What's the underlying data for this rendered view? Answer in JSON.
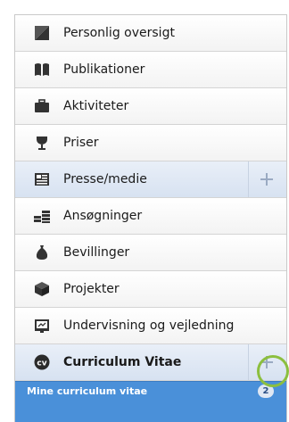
{
  "menu": {
    "items": [
      {
        "label": "Personlig oversigt",
        "icon": "user-card-icon"
      },
      {
        "label": "Publikationer",
        "icon": "book-icon"
      },
      {
        "label": "Aktiviteter",
        "icon": "briefcase-icon"
      },
      {
        "label": "Priser",
        "icon": "trophy-icon"
      },
      {
        "label": "Presse/medie",
        "icon": "newspaper-icon"
      },
      {
        "label": "Ansøgninger",
        "icon": "money-stack-icon"
      },
      {
        "label": "Bevillinger",
        "icon": "money-bag-icon"
      },
      {
        "label": "Projekter",
        "icon": "cube-icon"
      },
      {
        "label": "Undervisning og vejledning",
        "icon": "chalkboard-icon"
      },
      {
        "label": "Curriculum Vitae",
        "icon": "cv-icon"
      }
    ]
  },
  "submenu": {
    "label": "Mine curriculum vitae",
    "count": "2"
  },
  "colors": {
    "highlight_bg": "#d7e2f1",
    "submenu_bg": "#4a90d9",
    "ring": "#8cbf3f",
    "icon": "#2f2f2f"
  }
}
